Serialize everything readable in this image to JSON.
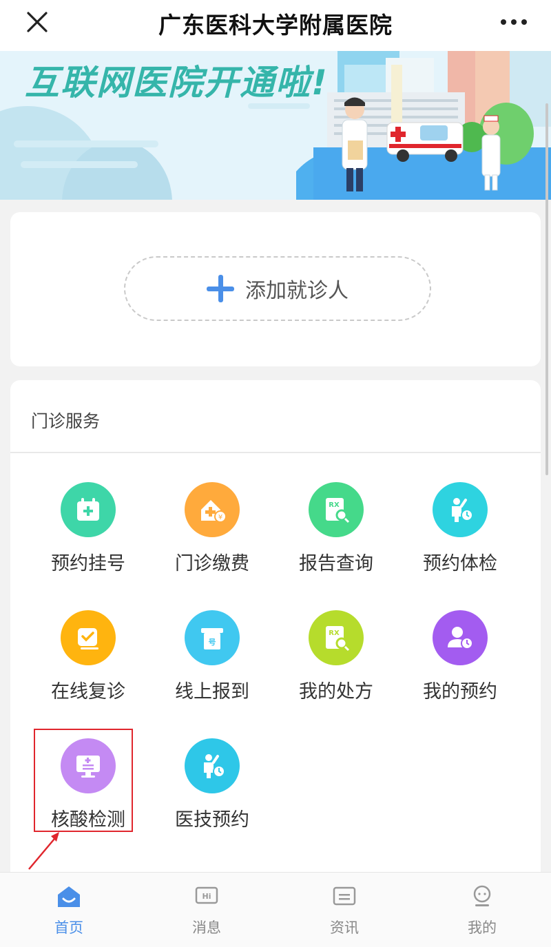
{
  "nav": {
    "title": "广东医科大学附属医院",
    "close_icon": "close-icon",
    "more_icon": "more-dots-icon"
  },
  "banner": {
    "headline": "互联网医院开通啦!"
  },
  "patient": {
    "add_label": "添加就诊人"
  },
  "services": {
    "title": "门诊服务",
    "items": [
      {
        "label": "预约挂号",
        "icon": "calendar-plus-icon",
        "color": "#3ed6a8"
      },
      {
        "label": "门诊缴费",
        "icon": "hospital-payment-icon",
        "color": "#ffaa3c"
      },
      {
        "label": "报告查询",
        "icon": "rx-report-search-icon",
        "color": "#45d98a"
      },
      {
        "label": "预约体检",
        "icon": "person-clock-icon",
        "color": "#2ed3e0"
      },
      {
        "label": "在线复诊",
        "icon": "check-card-icon",
        "color": "#ffb40f"
      },
      {
        "label": "线上报到",
        "icon": "ticket-number-icon",
        "color": "#40c8f0"
      },
      {
        "label": "我的处方",
        "icon": "rx-prescription-icon",
        "color": "#b6dc2c"
      },
      {
        "label": "我的预约",
        "icon": "user-clock-icon",
        "color": "#a35cf0"
      },
      {
        "label": "核酸检测",
        "icon": "monitor-test-icon",
        "color": "#c48af3"
      },
      {
        "label": "医技预约",
        "icon": "person-clock-icon",
        "color": "#2ec7e8"
      }
    ]
  },
  "tabbar": {
    "tabs": [
      {
        "label": "首页",
        "icon": "home-icon",
        "active": true
      },
      {
        "label": "消息",
        "icon": "message-hi-icon",
        "active": false
      },
      {
        "label": "资讯",
        "icon": "news-icon",
        "active": false
      },
      {
        "label": "我的",
        "icon": "profile-icon",
        "active": false
      }
    ]
  },
  "colors": {
    "accent": "#4a8fe8",
    "highlight_box": "#e0262d"
  }
}
